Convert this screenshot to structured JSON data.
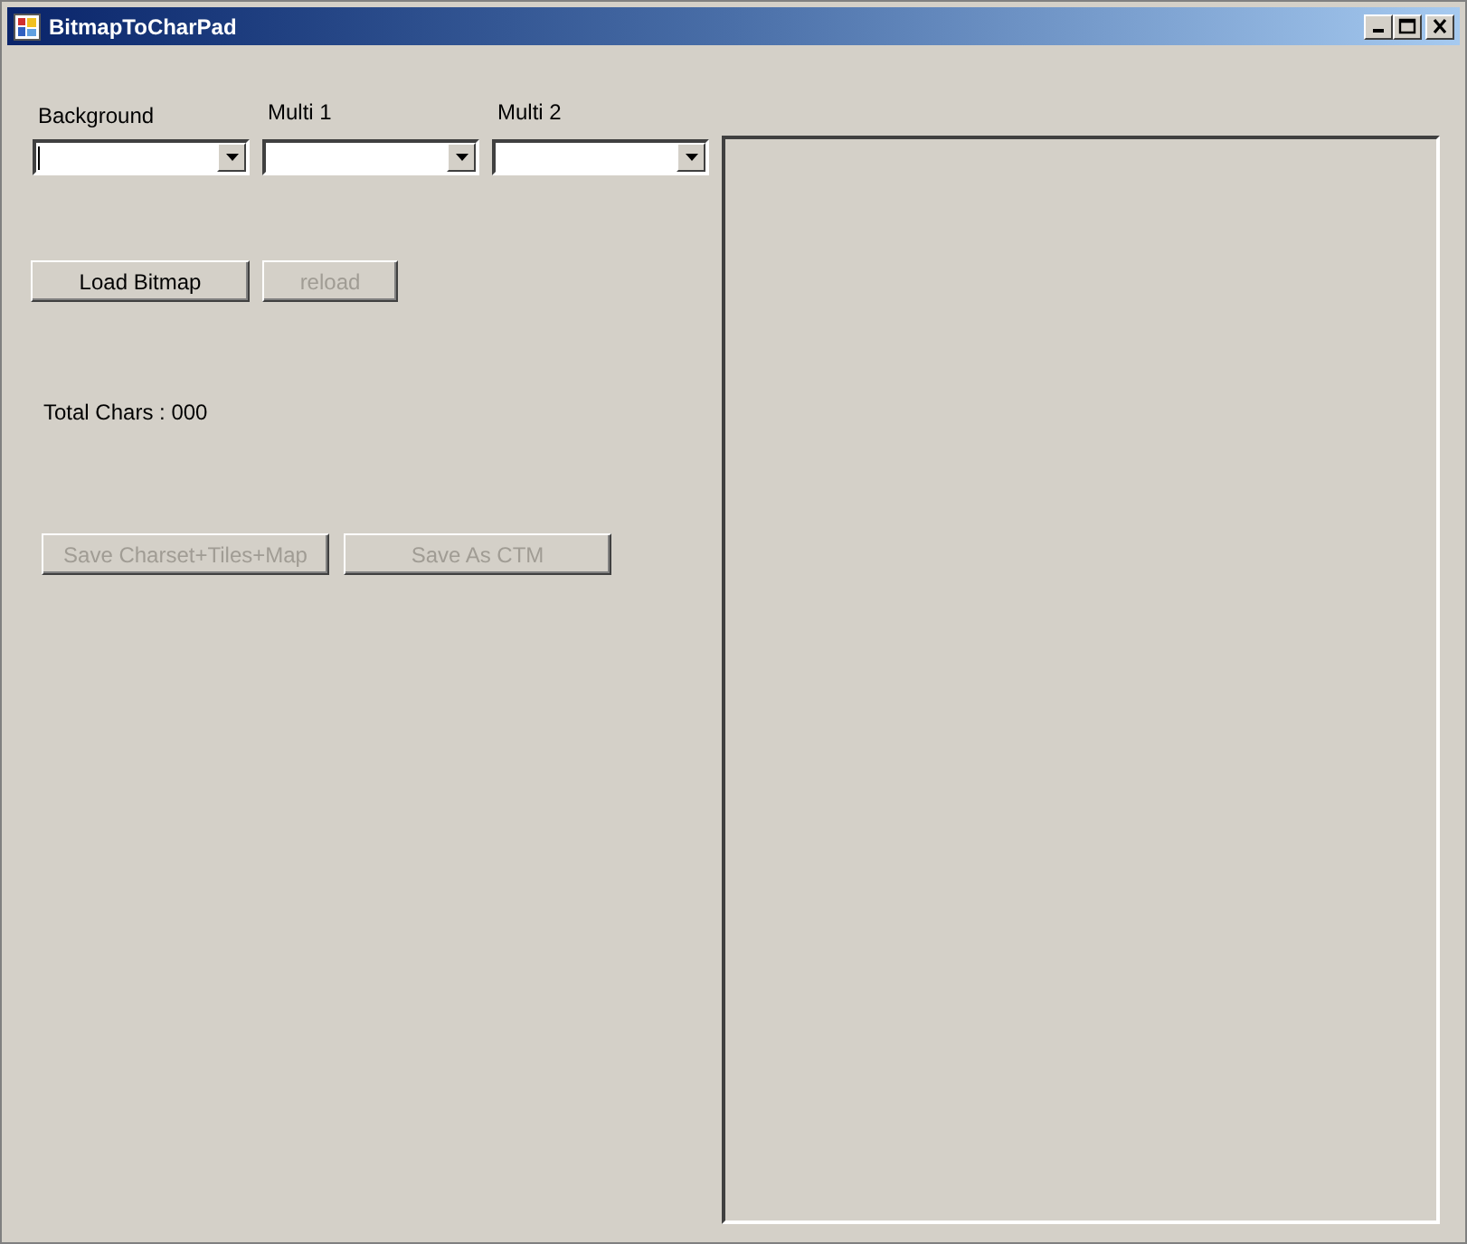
{
  "window": {
    "title": "BitmapToCharPad"
  },
  "combos": [
    {
      "label": "Background",
      "focused": true
    },
    {
      "label": "Multi 1",
      "focused": false
    },
    {
      "label": "Multi 2",
      "focused": false
    }
  ],
  "load_buttons": [
    {
      "label": "Load Bitmap",
      "disabled": false
    },
    {
      "label": "reload",
      "disabled": true
    }
  ],
  "total_chars": "Total Chars : 000",
  "save_buttons": [
    {
      "label": "Save Charset+Tiles+Map",
      "disabled": true
    },
    {
      "label": "Save As CTM",
      "disabled": true
    }
  ]
}
